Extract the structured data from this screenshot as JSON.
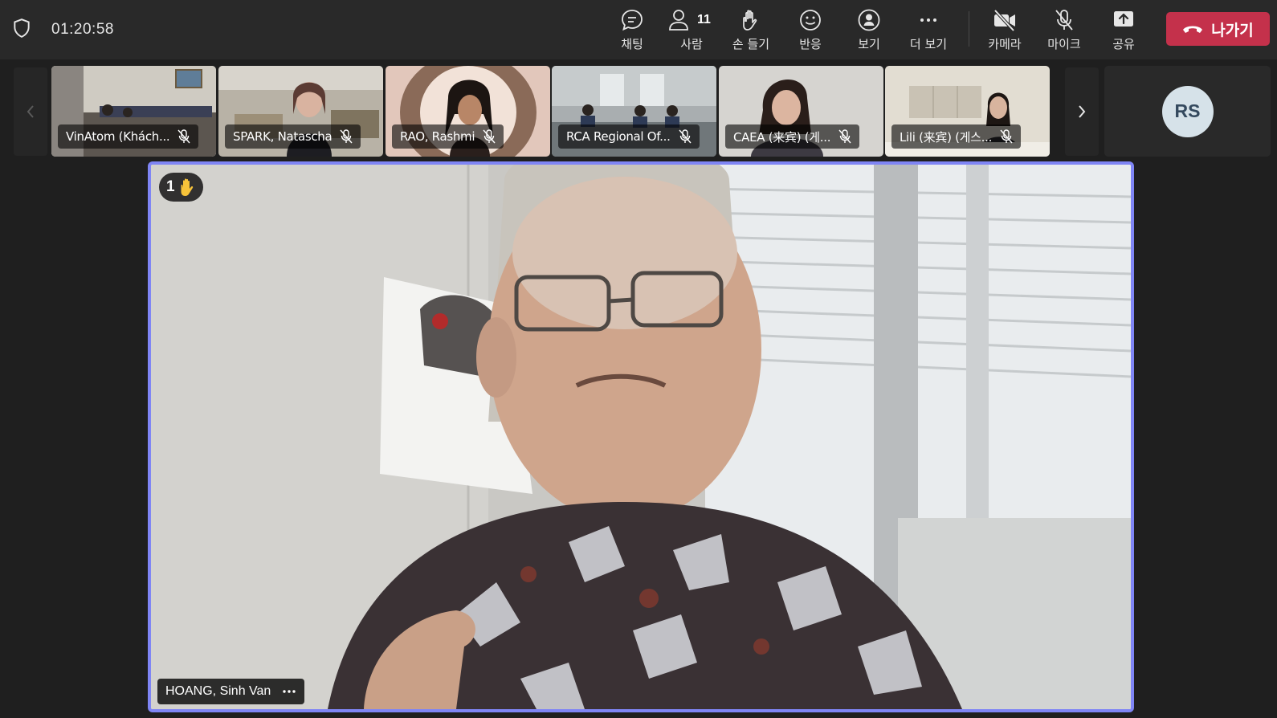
{
  "meeting": {
    "elapsed": "01:20:58"
  },
  "toolbar": {
    "chat": "채팅",
    "people": "사람",
    "people_count": "11",
    "raise_hand": "손 들기",
    "react": "반응",
    "view": "보기",
    "more": "더 보기",
    "camera": "카메라",
    "mic": "마이크",
    "share": "공유",
    "leave": "나가기"
  },
  "participants": [
    {
      "name": "VinAtom (Khách..."
    },
    {
      "name": "SPARK, Natascha"
    },
    {
      "name": "RAO, Rashmi"
    },
    {
      "name": "RCA Regional Of..."
    },
    {
      "name": "CAEA (来宾) (게..."
    },
    {
      "name": "Lili (来宾) (게스..."
    }
  ],
  "avatar_tile": {
    "initials": "RS"
  },
  "stage": {
    "raised_hands": "1",
    "speaker_name": "HOANG, Sinh Van"
  },
  "colors": {
    "leave": "#c4314b",
    "focus_border": "#7f85f5",
    "hand": "#f7c33a"
  }
}
